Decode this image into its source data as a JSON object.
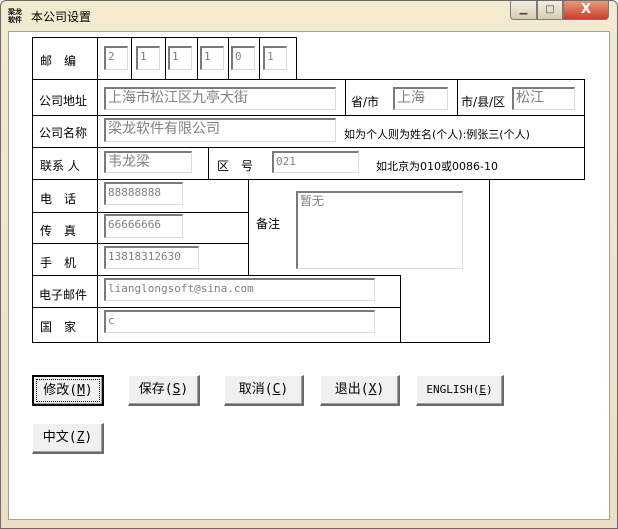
{
  "window": {
    "title": "本公司设置",
    "icon_text": "梁龙软件",
    "minimize_icon": "minimize-icon",
    "maximize_icon": "maximize-icon",
    "close_icon": "close-icon"
  },
  "form": {
    "zip_label": "邮　编",
    "zip_digits": [
      "2",
      "1",
      "1",
      "1",
      "0",
      "1"
    ],
    "address_label": "公司地址",
    "address_value": "上海市松江区九亭大街",
    "province_label": "省/市",
    "province_value": "上海",
    "city_label": "市/县/区",
    "city_value": "松江",
    "name_label": "公司名称",
    "name_value": "梁龙软件有限公司",
    "name_hint": "如为个人则为姓名(个人):例张三(个人)",
    "contact_label": "联系 人",
    "contact_value": "韦龙梁",
    "area_code_label": "区　号",
    "area_code_value": "021",
    "area_code_hint": "如北京为010或0086-10",
    "phone_label": "电　话",
    "phone_value": "88888888",
    "fax_label": "传　真",
    "fax_value": "66666666",
    "mobile_label": "手　机",
    "mobile_value": "13818312630",
    "notes_label": "备注",
    "notes_value": "暂无",
    "email_label": "电子邮件",
    "email_value": "lianglongsoft@sina.com",
    "country_label": "国　家",
    "country_value": "c"
  },
  "buttons": [
    {
      "label": "修改",
      "key": "M"
    },
    {
      "label": "保存",
      "key": "S"
    },
    {
      "label": "取消",
      "key": "C"
    },
    {
      "label": "退出",
      "key": "X"
    },
    {
      "label": "ENGLISH",
      "key": "E"
    },
    {
      "label": "中文",
      "key": "Z"
    }
  ]
}
